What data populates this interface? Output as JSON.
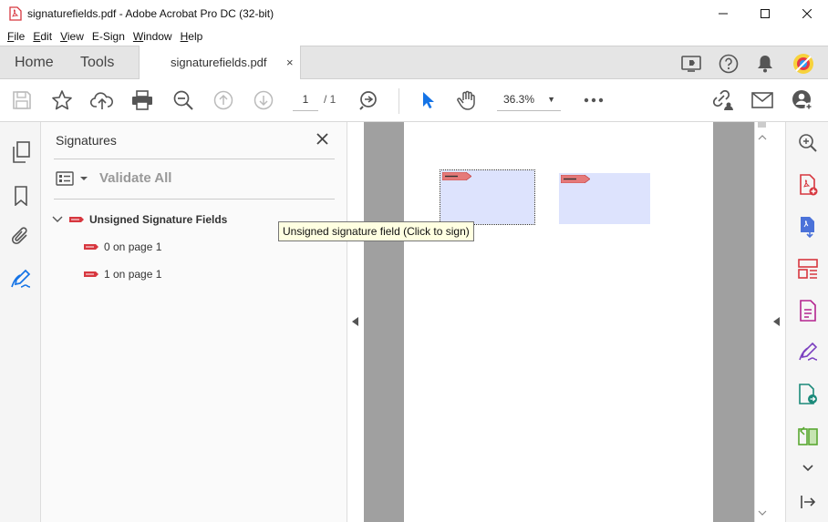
{
  "window": {
    "title": "signaturefields.pdf - Adobe Acrobat Pro DC (32-bit)",
    "minimize_icon": "minimize-icon",
    "maximize_icon": "maximize-icon",
    "close_icon": "close-icon"
  },
  "menu": {
    "items": [
      {
        "ul": "F",
        "rest": "ile"
      },
      {
        "ul": "E",
        "rest": "dit"
      },
      {
        "ul": "V",
        "rest": "iew"
      },
      {
        "ul": "",
        "rest": "E-Sign"
      },
      {
        "ul": "W",
        "rest": "indow"
      },
      {
        "ul": "H",
        "rest": "elp"
      }
    ]
  },
  "tabs": {
    "home": "Home",
    "tools": "Tools",
    "document": "signaturefields.pdf",
    "document_close": "×"
  },
  "toolbar": {
    "current_page": "1",
    "page_total": "/ 1",
    "zoom": "36.3%"
  },
  "signatures_panel": {
    "title": "Signatures",
    "validate_all": "Validate All",
    "group_label": "Unsigned Signature Fields",
    "fields": [
      {
        "label": "0 on page 1"
      },
      {
        "label": "1 on page 1"
      }
    ]
  },
  "tooltip": {
    "text": "Unsigned signature field (Click to sign)"
  },
  "colors": {
    "accent_blue": "#1473e6",
    "signature_field_fill": "#dde3fd",
    "pdf_red": "#d7373f",
    "tooltip_bg": "#ffffe1"
  }
}
